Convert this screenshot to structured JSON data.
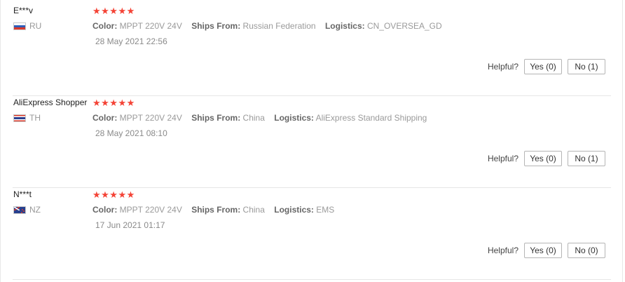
{
  "reviews": [
    {
      "user": "E***v",
      "country": "RU",
      "rating_stars": "★★★★★",
      "color_label": "Color:",
      "color_value": "MPPT 220V 24V",
      "ships_label": "Ships From:",
      "ships_value": "Russian Federation",
      "logistics_label": "Logistics:",
      "logistics_value": "CN_OVERSEA_GD",
      "date": "28 May 2021 22:56",
      "helpful_label": "Helpful?",
      "yes_label": "Yes (0)",
      "no_label": "No (1)"
    },
    {
      "user": "AliExpress Shopper",
      "country": "TH",
      "rating_stars": "★★★★★",
      "color_label": "Color:",
      "color_value": "MPPT 220V 24V",
      "ships_label": "Ships From:",
      "ships_value": "China",
      "logistics_label": "Logistics:",
      "logistics_value": "AliExpress Standard Shipping",
      "date": "28 May 2021 08:10",
      "helpful_label": "Helpful?",
      "yes_label": "Yes (0)",
      "no_label": "No (1)"
    },
    {
      "user": "N***t",
      "country": "NZ",
      "rating_stars": "★★★★★",
      "color_label": "Color:",
      "color_value": "MPPT 220V 24V",
      "ships_label": "Ships From:",
      "ships_value": "China",
      "logistics_label": "Logistics:",
      "logistics_value": "EMS",
      "date": "17 Jun 2021 01:17",
      "helpful_label": "Helpful?",
      "yes_label": "Yes (0)",
      "no_label": "No (0)"
    }
  ],
  "colors": {
    "star": "#f44336",
    "divider": "#e6e6e6",
    "muted_text": "#9a9a9a"
  }
}
